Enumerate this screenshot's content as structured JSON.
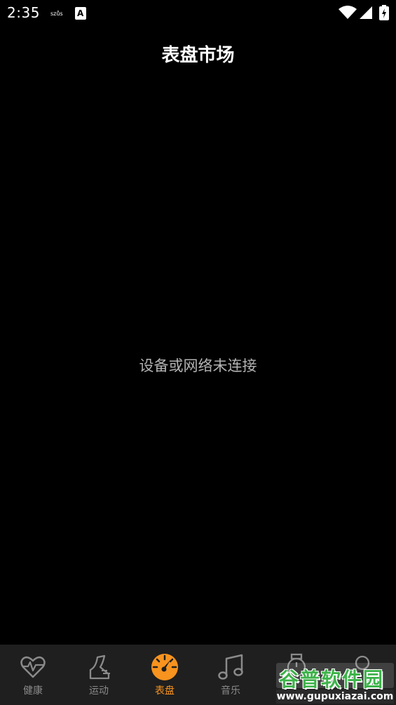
{
  "status_bar": {
    "time": "2:35",
    "icons": [
      "notification-icon",
      "a-badge-icon",
      "wifi-icon",
      "cell-signal-icon",
      "battery-icon"
    ]
  },
  "header": {
    "title": "表盘市场"
  },
  "main": {
    "message": "设备或网络未连接"
  },
  "tabbar": {
    "active_color": "#f7931e",
    "inactive_color": "#8a8a8a",
    "tabs": [
      {
        "label": "健康",
        "icon": "heart-pulse-icon"
      },
      {
        "label": "运动",
        "icon": "shoe-icon"
      },
      {
        "label": "表盘",
        "icon": "dial-icon",
        "active": true
      },
      {
        "label": "音乐",
        "icon": "music-note-icon"
      },
      {
        "label": "",
        "icon": "watch-icon"
      },
      {
        "label": "",
        "icon": "profile-icon"
      }
    ]
  },
  "watermark": {
    "brand": "谷普软件园",
    "url": "www.gupuxiazai.com"
  }
}
